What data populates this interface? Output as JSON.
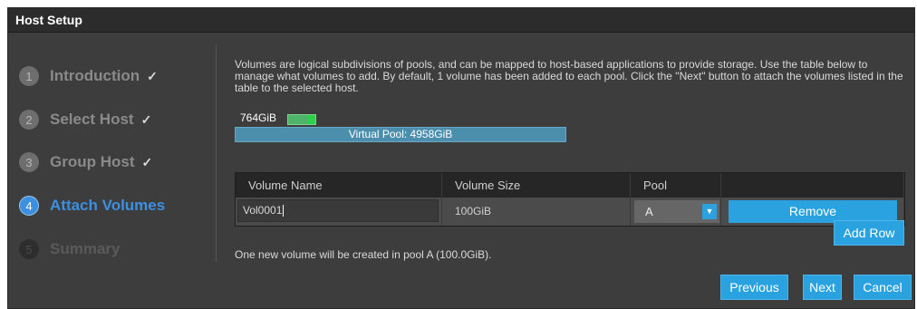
{
  "window": {
    "title": "Host Setup"
  },
  "steps": [
    {
      "number": "1",
      "label": "Introduction",
      "check": "✓",
      "state": "done"
    },
    {
      "number": "2",
      "label": "Select Host",
      "check": "✓",
      "state": "done"
    },
    {
      "number": "3",
      "label": "Group Host",
      "check": "✓",
      "state": "done"
    },
    {
      "number": "4",
      "label": "Attach Volumes",
      "check": "",
      "state": "active"
    },
    {
      "number": "5",
      "label": "Summary",
      "check": "",
      "state": "future"
    }
  ],
  "main": {
    "description": "Volumes are logical subdivisions of pools, and can be mapped to host-based applications to provide storage. Use the table below to manage what volumes to add. By default, 1 volume has been added to each pool. Click the \"Next\" button to attach the volumes listed in the table to the selected host.",
    "pool_meter": {
      "used_label": "764GiB",
      "pool_label": "Virtual Pool: 4958GiB"
    },
    "table": {
      "headers": [
        "Volume Name",
        "Volume Size",
        "Pool",
        ""
      ],
      "rows": [
        {
          "volume_name": "Vol0001",
          "volume_size": "100GiB",
          "pool": "A",
          "remove_label": "Remove"
        }
      ]
    },
    "add_row_label": "Add Row",
    "note": "One new volume will be created in pool A (100.0GiB)."
  },
  "footer": {
    "previous_label": "Previous",
    "next_label": "Next",
    "cancel_label": "Cancel"
  },
  "colors": {
    "accent": "#2aa2df",
    "active_step": "#3d8fe0",
    "background": "#3d3d3d"
  }
}
